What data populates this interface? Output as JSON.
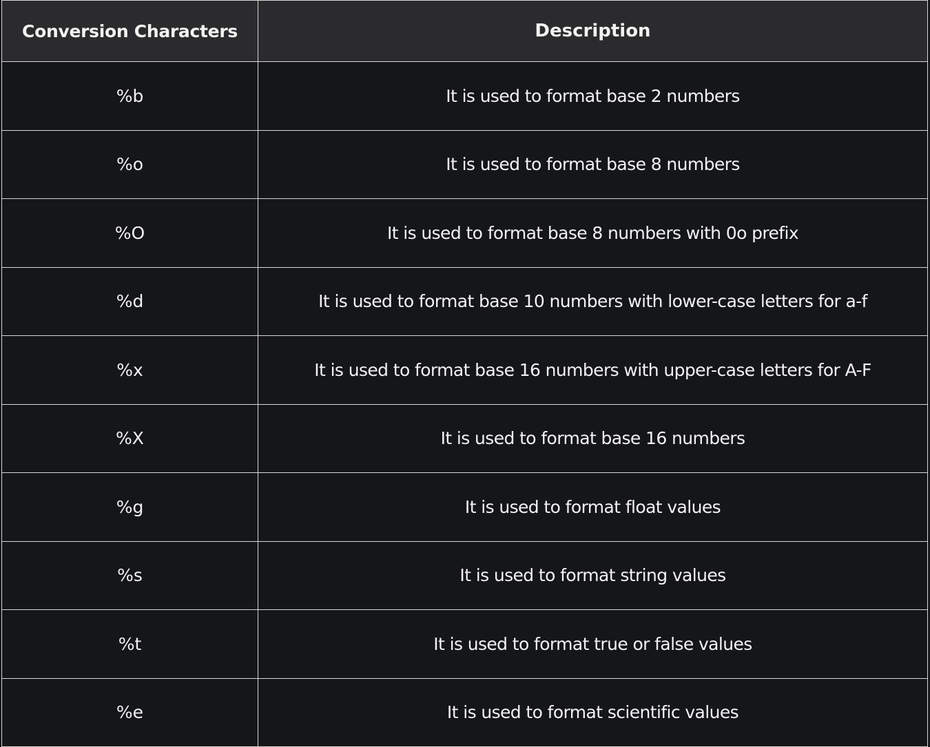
{
  "table": {
    "headers": [
      "Conversion Characters",
      "Description"
    ],
    "rows": [
      {
        "char": "%b",
        "desc": "It is used to format base 2 numbers"
      },
      {
        "char": "%o",
        "desc": "It is used to format base 8 numbers"
      },
      {
        "char": "%O",
        "desc": "It is used to format base 8 numbers with 0o prefix"
      },
      {
        "char": "%d",
        "desc": "It is used to format base 10 numbers with lower-case letters for a-f"
      },
      {
        "char": "%x",
        "desc": "It is used to format base 16 numbers with upper-case letters for A-F"
      },
      {
        "char": "%X",
        "desc": "It is used to format base 16 numbers"
      },
      {
        "char": "%g",
        "desc": "It is used to format float values"
      },
      {
        "char": "%s",
        "desc": "It is used to format string values"
      },
      {
        "char": "%t",
        "desc": "It is used to format true or false values"
      },
      {
        "char": "%e",
        "desc": "It is used to format scientific values"
      }
    ]
  }
}
